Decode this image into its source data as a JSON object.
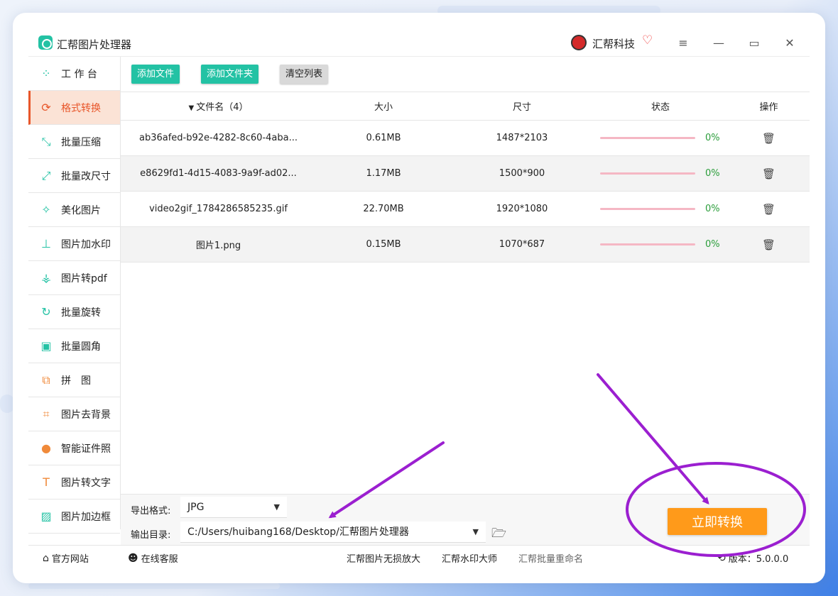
{
  "app": {
    "title": "汇帮图片处理器",
    "brand": "汇帮科技"
  },
  "sidebar": {
    "items": [
      {
        "label": "工 作 台",
        "icon": "grid-icon"
      },
      {
        "label": "格式转换",
        "icon": "convert-icon",
        "active": true
      },
      {
        "label": "批量压缩",
        "icon": "compress-icon"
      },
      {
        "label": "批量改尺寸",
        "icon": "resize-icon"
      },
      {
        "label": "美化图片",
        "icon": "beautify-icon"
      },
      {
        "label": "图片加水印",
        "icon": "watermark-icon"
      },
      {
        "label": "图片转pdf",
        "icon": "pdf-icon"
      },
      {
        "label": "批量旋转",
        "icon": "rotate-icon"
      },
      {
        "label": "批量圆角",
        "icon": "round-corner-icon"
      },
      {
        "label": "拼　图",
        "icon": "puzzle-icon"
      },
      {
        "label": "图片去背景",
        "icon": "crop-icon"
      },
      {
        "label": "智能证件照",
        "icon": "person-icon"
      },
      {
        "label": "图片转文字",
        "icon": "text-icon"
      },
      {
        "label": "图片加边框",
        "icon": "frame-icon"
      }
    ]
  },
  "toolbar": {
    "add_file": "添加文件",
    "add_folder": "添加文件夹",
    "clear_list": "清空列表"
  },
  "table": {
    "headers": {
      "name": "文件名（4）",
      "size": "大小",
      "dimensions": "尺寸",
      "status": "状态",
      "action": "操作"
    },
    "rows": [
      {
        "name": "ab36afed-b92e-4282-8c60-4aba...",
        "size": "0.61MB",
        "dimensions": "1487*2103",
        "progress": "0%"
      },
      {
        "name": "e8629fd1-4d15-4083-9a9f-ad02...",
        "size": "1.17MB",
        "dimensions": "1500*900",
        "progress": "0%"
      },
      {
        "name": "video2gif_1784286585235.gif",
        "size": "22.70MB",
        "dimensions": "1920*1080",
        "progress": "0%"
      },
      {
        "name": "图片1.png",
        "size": "0.15MB",
        "dimensions": "1070*687",
        "progress": "0%"
      }
    ]
  },
  "settings": {
    "format_label": "导出格式:",
    "format_value": "JPG",
    "output_label": "输出目录:",
    "output_value": "C:/Users/huibang168/Desktop/汇帮图片处理器"
  },
  "convert_button": "立即转换",
  "footer": {
    "website": "官方网站",
    "support": "在线客服",
    "link1": "汇帮图片无损放大",
    "link2": "汇帮水印大师",
    "link3": "汇帮批量重命名",
    "version": "版本：5.0.0.0"
  },
  "colors": {
    "accent_teal": "#23c2a4",
    "active_orange": "#e8562a",
    "convert_orange": "#ff9a1a",
    "annotation_purple": "#9b1fd0"
  }
}
